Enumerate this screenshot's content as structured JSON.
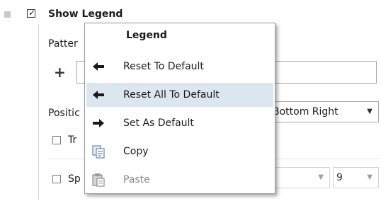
{
  "panel": {
    "show_legend": {
      "label": "Show Legend",
      "checked": true
    },
    "pattern_label": "Patter",
    "add_symbol": "+",
    "position_label": "Positic",
    "position_value": "Bottom Right",
    "transparent_label": "Tr",
    "spacing_label": "Sp",
    "spacing_value": "9"
  },
  "menu": {
    "header": "Legend",
    "items": [
      {
        "label": "Reset To Default",
        "icon": "arrow-left-icon",
        "enabled": true,
        "highlighted": false
      },
      {
        "label": "Reset All To Default",
        "icon": "arrow-left-icon",
        "enabled": true,
        "highlighted": true
      },
      {
        "label": "Set As Default",
        "icon": "arrow-right-icon",
        "enabled": true,
        "highlighted": false
      },
      {
        "label": "Copy",
        "icon": "copy-icon",
        "enabled": true,
        "highlighted": false
      },
      {
        "label": "Paste",
        "icon": "paste-icon",
        "enabled": false,
        "highlighted": false
      }
    ]
  },
  "colors": {
    "highlight": "#dce6f1",
    "border": "#9a9a9a",
    "disabled_text": "#8a8a8a"
  }
}
